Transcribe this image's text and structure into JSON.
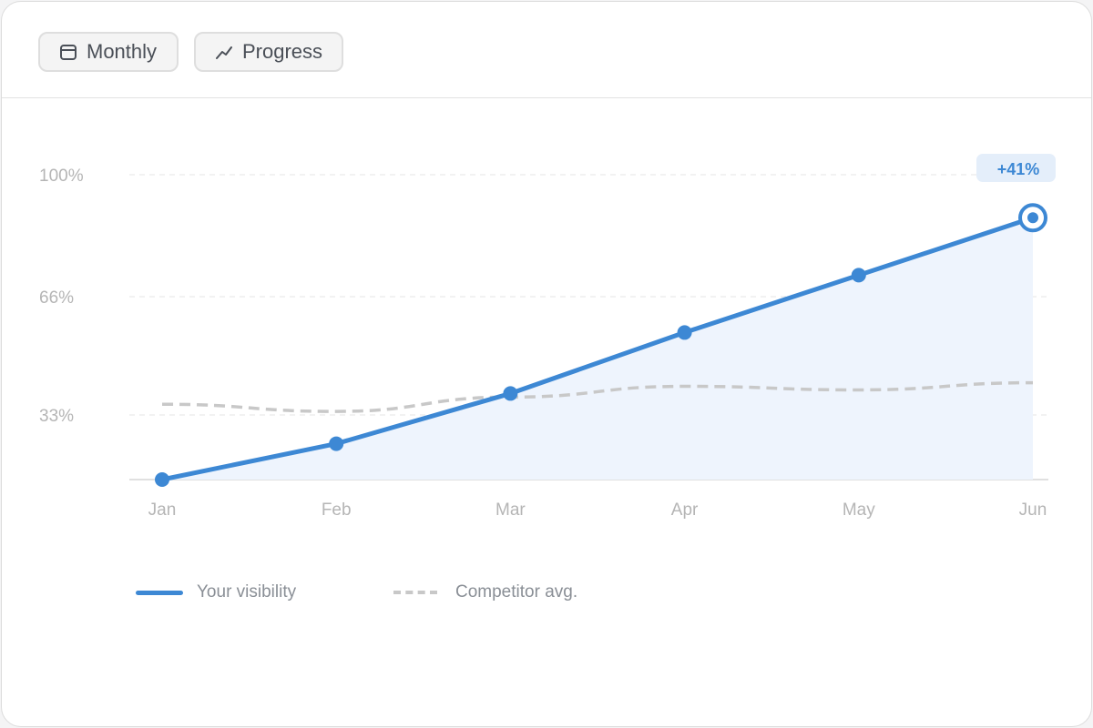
{
  "toolbar": {
    "monthly_label": "Monthly",
    "monthly_icon": "calendar-icon",
    "progress_label": "Progress",
    "progress_icon": "trend-line-icon"
  },
  "colors": {
    "primary": "#3d88d4",
    "area_fill": "#eef4fd",
    "competitor": "#c8c8c8",
    "grid": "#e6e6e6",
    "axis_text": "#b5b5b5",
    "badge_bg": "#e4eefa"
  },
  "chart_data": {
    "type": "line",
    "categories": [
      "Jan",
      "Feb",
      "Mar",
      "Apr",
      "May",
      "Jun"
    ],
    "series": [
      {
        "name": "Your visibility",
        "values": [
          15,
          25,
          39,
          56,
          72,
          88
        ],
        "style": "solid",
        "markers": true,
        "area": true
      },
      {
        "name": "Competitor avg.",
        "values": [
          36,
          34,
          38,
          41,
          40,
          42
        ],
        "style": "dashed",
        "markers": false,
        "area": false
      }
    ],
    "yticks": [
      {
        "value": 33,
        "label": "33%"
      },
      {
        "value": 66,
        "label": "66%"
      },
      {
        "value": 100,
        "label": "100%"
      }
    ],
    "ylim": [
      15,
      100
    ],
    "grid": true,
    "annotation": {
      "text": "+41%",
      "category": "Jun",
      "series": "Your visibility"
    },
    "legend_position": "bottom-left"
  }
}
